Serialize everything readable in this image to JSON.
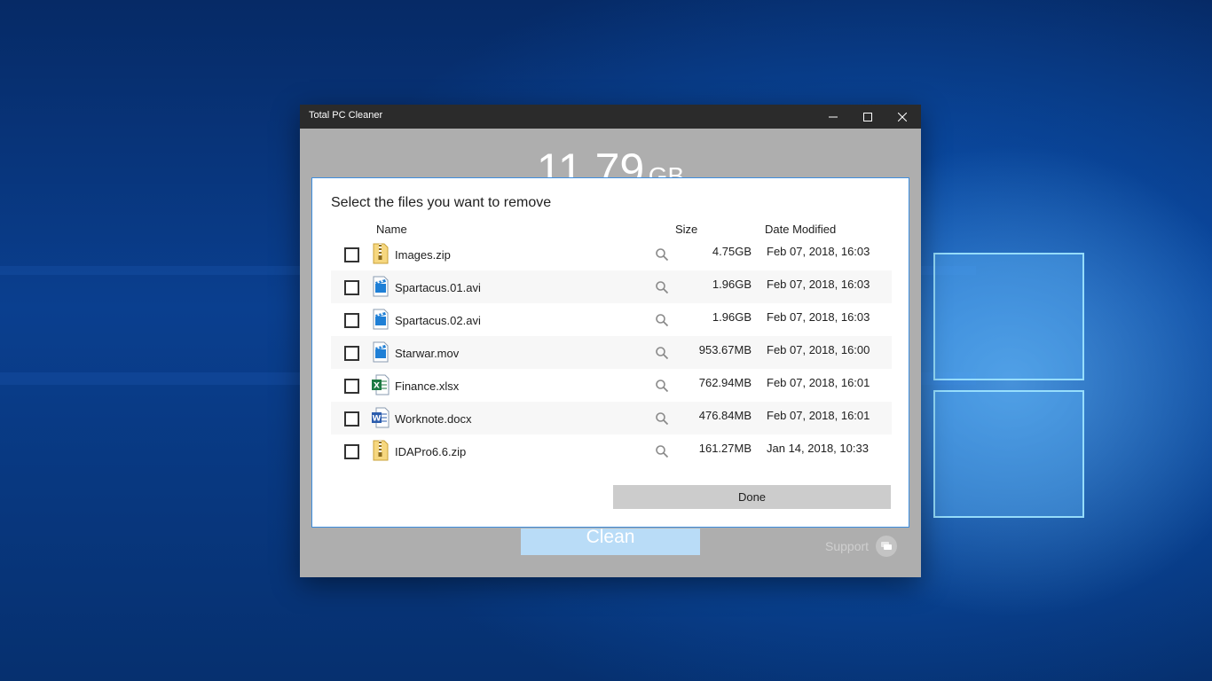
{
  "window": {
    "title": "Total PC Cleaner",
    "controls": [
      "minimize-icon",
      "maximize-icon",
      "close-icon"
    ]
  },
  "summary": {
    "size_value": "11.79",
    "size_unit": "GB"
  },
  "dialog": {
    "heading": "Select the files you want to remove",
    "columns": {
      "name": "Name",
      "size": "Size",
      "date": "Date Modified"
    },
    "files": [
      {
        "name": "Images.zip",
        "icon": "zip-file-icon",
        "size": "4.75GB",
        "date": "Feb 07, 2018, 16:03",
        "checked": false
      },
      {
        "name": "Spartacus.01.avi",
        "icon": "video-file-icon",
        "size": "1.96GB",
        "date": "Feb 07, 2018, 16:03",
        "checked": false
      },
      {
        "name": "Spartacus.02.avi",
        "icon": "video-file-icon",
        "size": "1.96GB",
        "date": "Feb 07, 2018, 16:03",
        "checked": false
      },
      {
        "name": "Starwar.mov",
        "icon": "video-file-icon",
        "size": "953.67MB",
        "date": "Feb 07, 2018, 16:00",
        "checked": false
      },
      {
        "name": "Finance.xlsx",
        "icon": "excel-file-icon",
        "size": "762.94MB",
        "date": "Feb 07, 2018, 16:01",
        "checked": false
      },
      {
        "name": "Worknote.docx",
        "icon": "word-file-icon",
        "size": "476.84MB",
        "date": "Feb 07, 2018, 16:01",
        "checked": false
      },
      {
        "name": "IDAPro6.6.zip",
        "icon": "zip-file-icon",
        "size": "161.27MB",
        "date": "Jan 14, 2018, 10:33",
        "checked": false
      }
    ],
    "done_label": "Done"
  },
  "footer": {
    "clean_label": "Clean",
    "support_label": "Support"
  },
  "colors": {
    "accent": "#3e8ede",
    "clean_button": "#b9dcf7",
    "titlebar": "#2b2b2b"
  }
}
